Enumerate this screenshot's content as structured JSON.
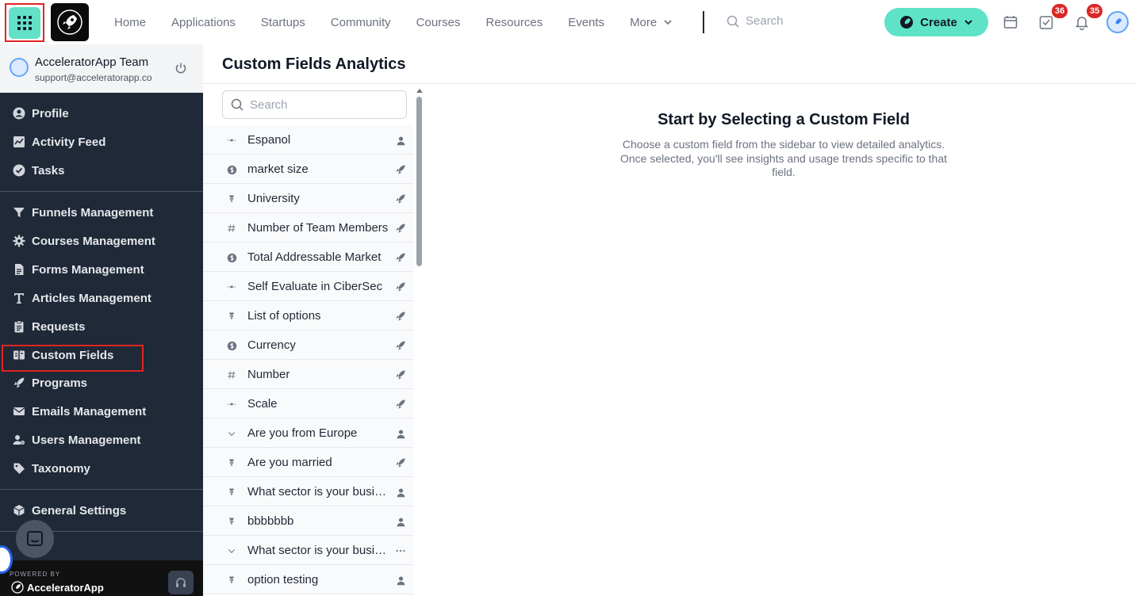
{
  "topbar": {
    "nav": [
      {
        "label": "Home"
      },
      {
        "label": "Applications"
      },
      {
        "label": "Startups"
      },
      {
        "label": "Community"
      },
      {
        "label": "Courses"
      },
      {
        "label": "Resources"
      },
      {
        "label": "Events"
      },
      {
        "label": "More"
      }
    ],
    "search_placeholder": "Search",
    "create_label": "Create",
    "tasks_badge": "36",
    "notifications_badge": "35"
  },
  "sidebar": {
    "user_name": "AcceleratorApp Team",
    "user_email": "support@acceleratorapp.co",
    "items": [
      {
        "label": "Profile",
        "icon": "user-circle-icon"
      },
      {
        "label": "Activity Feed",
        "icon": "chart-icon"
      },
      {
        "label": "Tasks",
        "icon": "check-circle-icon"
      },
      {
        "label": "Funnels Management",
        "icon": "funnel-icon"
      },
      {
        "label": "Courses Management",
        "icon": "gear-icon"
      },
      {
        "label": "Forms Management",
        "icon": "document-icon"
      },
      {
        "label": "Articles Management",
        "icon": "text-icon"
      },
      {
        "label": "Requests",
        "icon": "clipboard-icon"
      },
      {
        "label": "Custom Fields",
        "icon": "custom-fields-icon"
      },
      {
        "label": "Programs",
        "icon": "rocket-icon"
      },
      {
        "label": "Emails Management",
        "icon": "envelope-icon"
      },
      {
        "label": "Users Management",
        "icon": "users-gear-icon"
      },
      {
        "label": "Taxonomy",
        "icon": "tag-icon"
      },
      {
        "label": "General Settings",
        "icon": "cube-icon"
      }
    ],
    "powered_by": "POWERED BY",
    "brand": "AcceleratorApp"
  },
  "main": {
    "title": "Custom Fields Analytics",
    "search_placeholder": "Search",
    "fields": [
      {
        "label": "Espanol",
        "type": "scale",
        "owner": "user"
      },
      {
        "label": "market size",
        "type": "currency",
        "owner": "startup"
      },
      {
        "label": "University",
        "type": "options",
        "owner": "startup"
      },
      {
        "label": "Number of Team Members",
        "type": "number",
        "owner": "startup"
      },
      {
        "label": "Total Addressable Market",
        "type": "currency",
        "owner": "startup"
      },
      {
        "label": "Self Evaluate in CiberSec",
        "type": "scale",
        "owner": "startup"
      },
      {
        "label": "List of options",
        "type": "options",
        "owner": "startup"
      },
      {
        "label": "Currency",
        "type": "currency",
        "owner": "startup"
      },
      {
        "label": "Number",
        "type": "number",
        "owner": "startup"
      },
      {
        "label": "Scale",
        "type": "scale",
        "owner": "startup"
      },
      {
        "label": "Are you from Europe",
        "type": "dropdown",
        "owner": "user"
      },
      {
        "label": "Are you married",
        "type": "options",
        "owner": "startup"
      },
      {
        "label": "What sector is your business",
        "type": "options",
        "owner": "user"
      },
      {
        "label": "bbbbbbb",
        "type": "options",
        "owner": "user"
      },
      {
        "label": "What sector is your business",
        "type": "dropdown",
        "owner": "more"
      },
      {
        "label": "option testing",
        "type": "options",
        "owner": "user"
      }
    ],
    "empty_title": "Start by Selecting a Custom Field",
    "empty_description": "Choose a custom field from the sidebar to view detailed analytics. Once selected, you'll see insights and usage trends specific to that field."
  },
  "colors": {
    "accent": "#5ee3c6",
    "sidebar_bg": "#1f2937",
    "highlight": "#e02424",
    "badge": "#dc2626"
  }
}
